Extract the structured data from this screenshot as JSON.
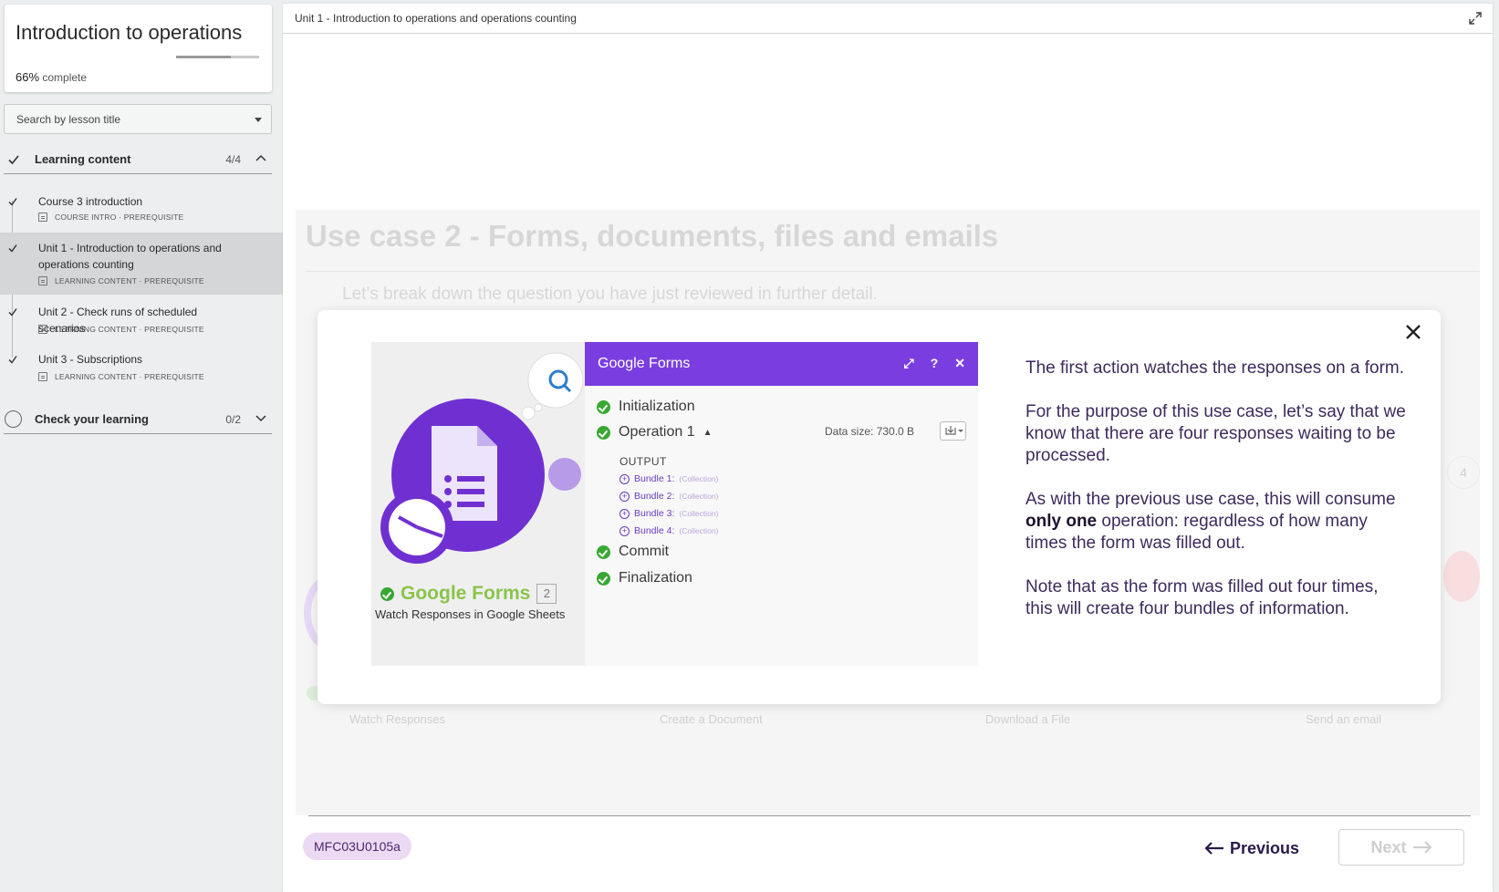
{
  "sidebar": {
    "course_title": "Introduction to operations",
    "progress_percent": "66%",
    "progress_value": 0.66,
    "progress_suffix": " complete",
    "search_placeholder": "Search by lesson title",
    "sections": [
      {
        "label": "Learning content",
        "count": "4/4",
        "status": "complete",
        "expanded": true
      },
      {
        "label": "Check your learning",
        "count": "0/2",
        "status": "not-started",
        "expanded": false
      }
    ],
    "lessons": [
      {
        "title": "Course 3 introduction",
        "meta": "COURSE INTRO · PREREQUISITE",
        "active": false
      },
      {
        "title": "Unit 1 - Introduction to operations and operations counting",
        "meta": "LEARNING CONTENT · PREREQUISITE",
        "active": true
      },
      {
        "title": "Unit 2 - Check runs of scheduled scenarios",
        "meta": "LEARNING CONTENT · PREREQUISITE",
        "active": false
      },
      {
        "title": "Unit 3 - Subscriptions",
        "meta": "LEARNING CONTENT · PREREQUISITE",
        "active": false
      }
    ]
  },
  "main": {
    "breadcrumb": "Unit 1 - Introduction to operations and operations counting",
    "heading": "Use case 2 - Forms, documents, files and emails",
    "lead": "Let’s break down the question you have just reviewed in further detail.",
    "ghost_labels": [
      "Watch Responses",
      "Create a Document",
      "Download a File",
      "Send an email"
    ],
    "ghost_step_number": "4",
    "lesson_code": "MFC03U0105a",
    "prev_label": "Previous",
    "next_label": "Next"
  },
  "modal": {
    "screenshot": {
      "panel_title": "Google Forms",
      "steps": [
        "Initialization",
        "Operation 1",
        "Commit",
        "Finalization"
      ],
      "output_label": "OUTPUT",
      "data_size": "Data size: 730.0 B",
      "bundles": [
        {
          "name": "Bundle 1:",
          "type": "(Collection)"
        },
        {
          "name": "Bundle 2:",
          "type": "(Collection)"
        },
        {
          "name": "Bundle 3:",
          "type": "(Collection)"
        },
        {
          "name": "Bundle 4:",
          "type": "(Collection)"
        }
      ],
      "module_name": "Google Forms",
      "module_number": "2",
      "module_action": "Watch Responses in Google Sheets"
    },
    "paragraph_1": "The first action watches the responses on a form.",
    "paragraph_2": "For the purpose of this use case, let’s say that we know that there are four responses waiting to be processed.",
    "paragraph_3_before": "As with the previous use case, this will consume ",
    "paragraph_3_bold": "only one",
    "paragraph_3_after": " operation: regardless of how many times the form was filled out.",
    "paragraph_4": "Note that as the form was filled out four times, this will create four bundles of information."
  },
  "colors": {
    "accent_purple": "#7a3ee0",
    "success_green": "#38a832",
    "pill_bg": "#ecd9f3",
    "text_dark_purple": "#3d2a5c"
  }
}
